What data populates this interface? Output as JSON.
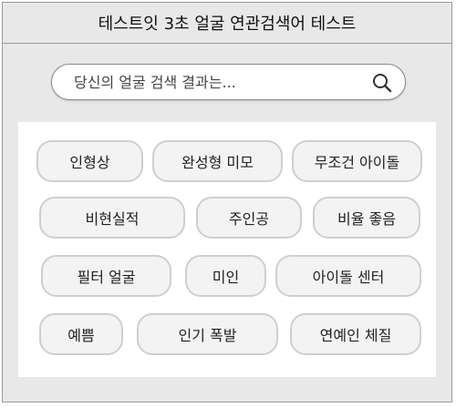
{
  "header": {
    "title": "테스트잇 3초 얼굴 연관검색어 테스트"
  },
  "search": {
    "placeholder": "당신의 얼굴 검색 결과는...",
    "icon": "search-icon"
  },
  "tags": [
    "인형상",
    "완성형 미모",
    "무조건 아이돌",
    "비현실적",
    "주인공",
    "비율 좋음",
    "필터 얼굴",
    "미인",
    "아이돌 센터",
    "예쁨",
    "인기 폭발",
    "연예인 체질"
  ]
}
